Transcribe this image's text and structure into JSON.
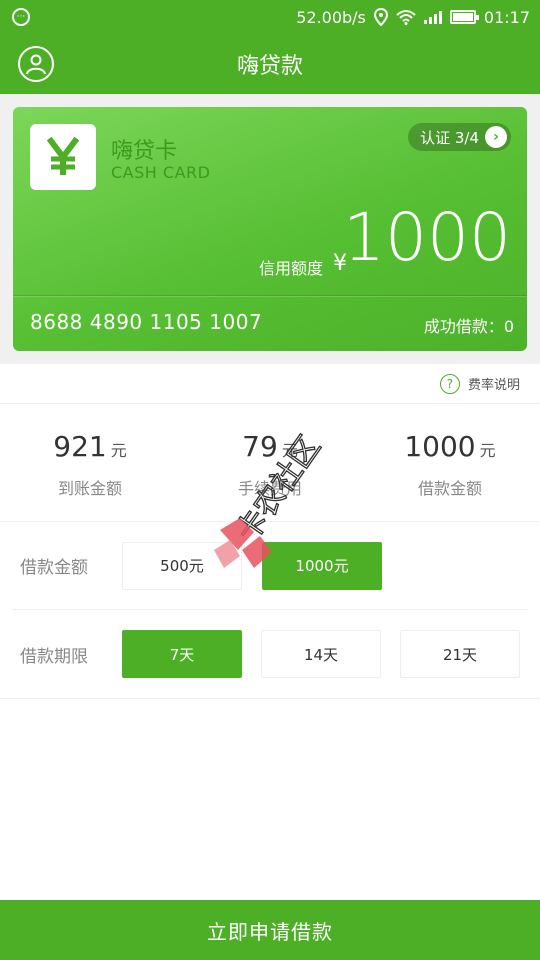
{
  "statusbar": {
    "speed": "52.00b/s",
    "time": "01:17"
  },
  "header": {
    "title": "嗨贷款"
  },
  "card": {
    "name": "嗨贷卡",
    "subtitle": "CASH CARD",
    "auth_label": "认证 3/4",
    "limit_label": "信用额度",
    "currency_symbol": "¥",
    "limit_value": "1000",
    "card_number": "8688 4890 1105 1007",
    "success_label": "成功借款：0"
  },
  "rate_link": "费率说明",
  "stats": [
    {
      "value": "921",
      "unit": "元",
      "label": "到账金额"
    },
    {
      "value": "79",
      "unit": "元",
      "label": "手续费用"
    },
    {
      "value": "1000",
      "unit": "元",
      "label": "借款金额"
    }
  ],
  "amount": {
    "label": "借款金额",
    "options": [
      "500元",
      "1000元"
    ],
    "selected": "1000元"
  },
  "term": {
    "label": "借款期限",
    "options": [
      "7天",
      "14天",
      "21天"
    ],
    "selected": "7天"
  },
  "watermark": "卡农社区",
  "footer": {
    "button": "立即申请借款"
  },
  "colors": {
    "primary": "#4caf25",
    "card_gradient_start": "#7dd65a"
  }
}
